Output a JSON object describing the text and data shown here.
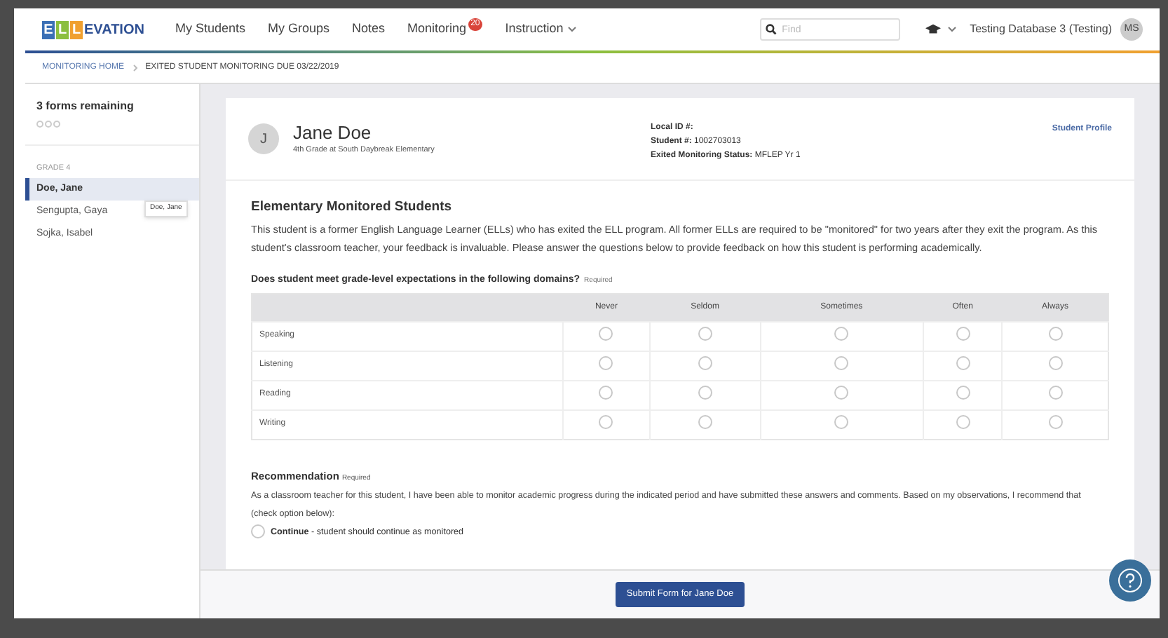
{
  "nav": {
    "logo": {
      "boxes": [
        "E",
        "L",
        "L"
      ],
      "rest": "EVATION"
    },
    "items": [
      {
        "label": "My Students",
        "dropdown": false
      },
      {
        "label": "My Groups",
        "dropdown": false
      },
      {
        "label": "Notes",
        "dropdown": false
      },
      {
        "label": "Monitoring",
        "badge": "20",
        "dropdown": false
      },
      {
        "label": "Instruction",
        "dropdown": true
      }
    ],
    "search": {
      "placeholder": "Find"
    },
    "account": "Testing Database 3 (Testing)",
    "avatar": "MS"
  },
  "breadcrumb": [
    "MONITORING HOME",
    "EXITED STUDENT MONITORING DUE 03/22/2019"
  ],
  "sidebar": {
    "title": "3 forms remaining",
    "progress": [
      false,
      false,
      false
    ],
    "group": "GRADE 4",
    "items": [
      {
        "label": "Doe, Jane",
        "selected": true
      },
      {
        "label": "Sengupta, Gaya",
        "selected": false
      },
      {
        "label": "Sojka, Isabel",
        "selected": false
      }
    ],
    "tooltip": "Doe, Jane"
  },
  "student": {
    "initial": "J",
    "name": "Jane Doe",
    "school": "4th Grade at South Daybreak Elementary",
    "fields": [
      {
        "label": "Local ID #:"
      },
      {
        "label": "Student #:",
        "value": "1002703013"
      },
      {
        "label": "Exited Monitoring Status:",
        "value": "MFLEP Yr 1"
      }
    ],
    "profile_link": "Student Profile"
  },
  "form": {
    "title": "Elementary Monitored Students",
    "intro": "This student is a former English Language Learner (ELLs) who has exited the ELL program. All former ELLs are required to be \"monitored\" for two years after they exit the program. As this student's classroom teacher, your feedback is invaluable. Please answer the questions below to provide feedback on how this student is performing academically.",
    "question": "Does student meet grade-level expectations in the following domains?",
    "question_required": "Required",
    "columns": [
      "Never",
      "Seldom",
      "Sometimes",
      "Often",
      "Always"
    ],
    "rows": [
      {
        "label": "Speaking",
        "answers": [
          false,
          false,
          false,
          false,
          false
        ]
      },
      {
        "label": "Listening",
        "answers": [
          false,
          false,
          false,
          false,
          false
        ]
      },
      {
        "label": "Reading",
        "answers": [
          false,
          false,
          false,
          false,
          false
        ]
      },
      {
        "label": "Writing",
        "answers": [
          false,
          false,
          false,
          false,
          false
        ]
      }
    ],
    "recommendation": {
      "title": "Recommendation",
      "required": "Required",
      "text": "As a classroom teacher for this student, I have been able to monitor academic progress during the indicated period and have submitted these answers and comments. Based on my observations, I recommend that (check option below):",
      "options": [
        {
          "label": "**Continue** - student should continue as monitored",
          "selected": false
        }
      ]
    }
  },
  "submit": "Submit Form for Jane Doe"
}
